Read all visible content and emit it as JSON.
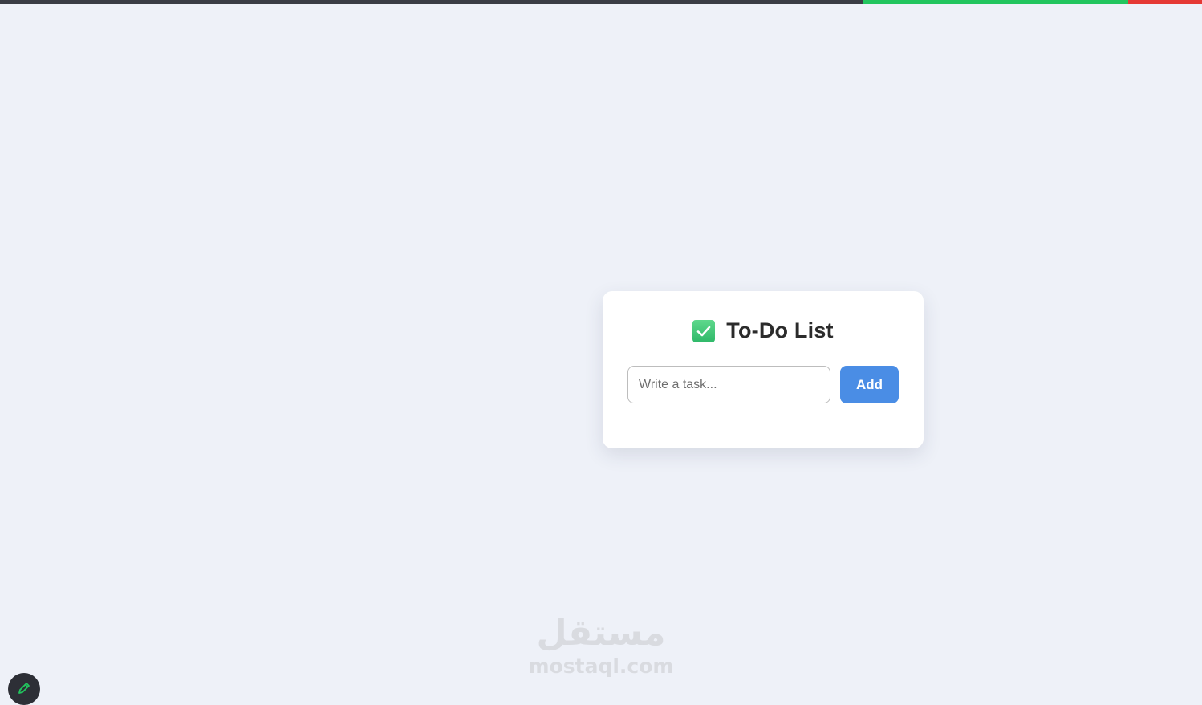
{
  "top_bar": {
    "colors": [
      "#3a3d45",
      "#22c55e",
      "#e53935"
    ]
  },
  "card": {
    "title_icon": "checkbox-checked-icon",
    "title": "To-Do List",
    "input": {
      "placeholder": "Write a task...",
      "value": ""
    },
    "add_label": "Add"
  },
  "watermark": {
    "arabic": "مستقل",
    "latin": "mostaql.com"
  },
  "fab": {
    "icon": "pencil-icon"
  },
  "colors": {
    "background": "#eef1f8",
    "accent": "#4a8de5",
    "check": "#2fb869"
  }
}
